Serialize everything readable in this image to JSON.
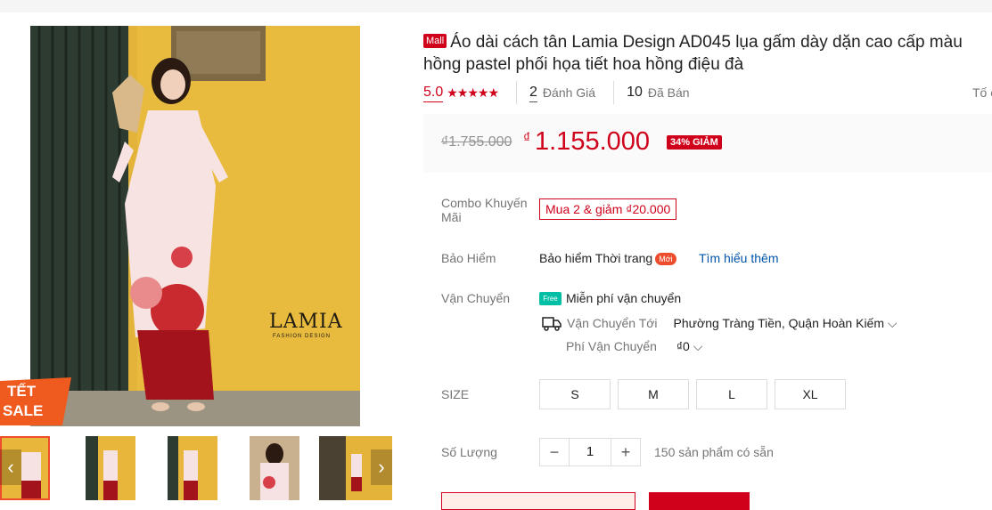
{
  "product": {
    "mall_badge": "Mall",
    "title_line1": "Áo dài cách tân Lamia Design AD045 lụa gấm dày dặn cao cấp màu",
    "title_line2": "hồng pastel phối họa tiết hoa hồng điệu đà"
  },
  "rating": {
    "score": "5.0",
    "stars": "★★★★★",
    "review_count": "2",
    "review_label": "Đánh Giá",
    "sold_count": "10",
    "sold_label": "Đã Bán",
    "report_label": "Tố c"
  },
  "price": {
    "original": "₫1.755.000",
    "currency": "₫",
    "current": "1.155.000",
    "discount": "34% GIẢM"
  },
  "combo": {
    "label": "Combo Khuyến Mãi",
    "tag": "Mua 2 & giảm ₫20.000"
  },
  "insurance": {
    "label": "Bảo Hiểm",
    "text": "Bảo hiểm Thời trang",
    "new_badge": "Mới",
    "learn_more": "Tìm hiểu thêm"
  },
  "shipping": {
    "label": "Vận Chuyển",
    "free_icon": "Free",
    "free_text": "Miễn phí vận chuyển",
    "to_label": "Vận Chuyển Tới",
    "to_value": "Phường Tràng Tiền, Quận Hoàn Kiếm",
    "fee_label": "Phí Vận Chuyển",
    "fee_value": "₫0"
  },
  "size": {
    "label": "SIZE",
    "options": [
      "S",
      "M",
      "L",
      "XL"
    ]
  },
  "quantity": {
    "label": "Số Lượng",
    "minus": "−",
    "value": "1",
    "plus": "+",
    "stock": "150 sản phẩm có sẵn"
  },
  "gallery": {
    "brand_logo": "LAMIA",
    "brand_sub": "FASHION DESIGN",
    "badge_top": "TẾT",
    "badge_bottom": "SALE",
    "prev": "‹",
    "next": "›"
  },
  "colors": {
    "accent": "#d0011b",
    "wall_yellow": "#e7b62d",
    "pants_red": "#a3131b",
    "dress_pink": "#f6e2e2"
  }
}
